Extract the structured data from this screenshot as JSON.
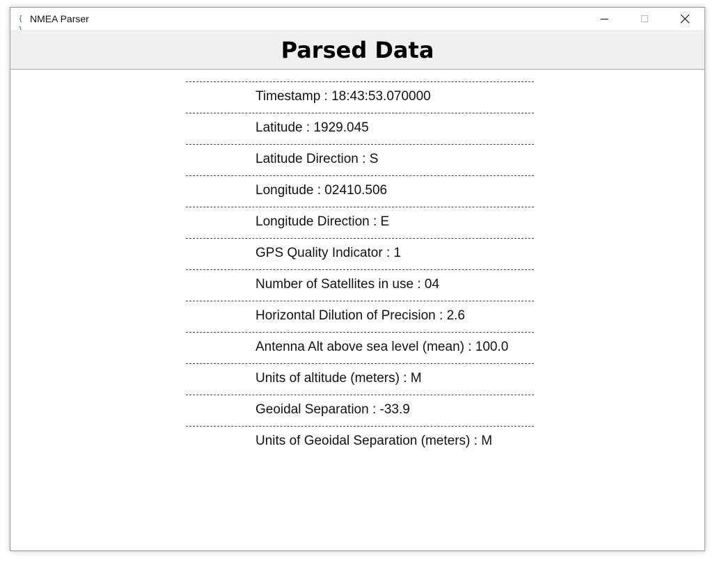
{
  "window": {
    "title": "NMEA Parser",
    "icon": "braces-icon",
    "icon_glyph": "{ }",
    "controls": [
      "minimize",
      "maximize",
      "close"
    ]
  },
  "header": {
    "title": "Parsed Data"
  },
  "fields": [
    "Timestamp : 18:43:53.070000",
    "Latitude : 1929.045",
    "Latitude Direction : S",
    "Longitude : 02410.506",
    "Longitude Direction : E",
    "GPS Quality Indicator : 1",
    "Number of Satellites in use : 04",
    "Horizontal Dilution of Precision : 2.6",
    "Antenna Alt above sea level (mean) : 100.0",
    "Units of altitude (meters) : M",
    "Geoidal Separation : -33.9",
    "Units of Geoidal Separation (meters) : M"
  ]
}
